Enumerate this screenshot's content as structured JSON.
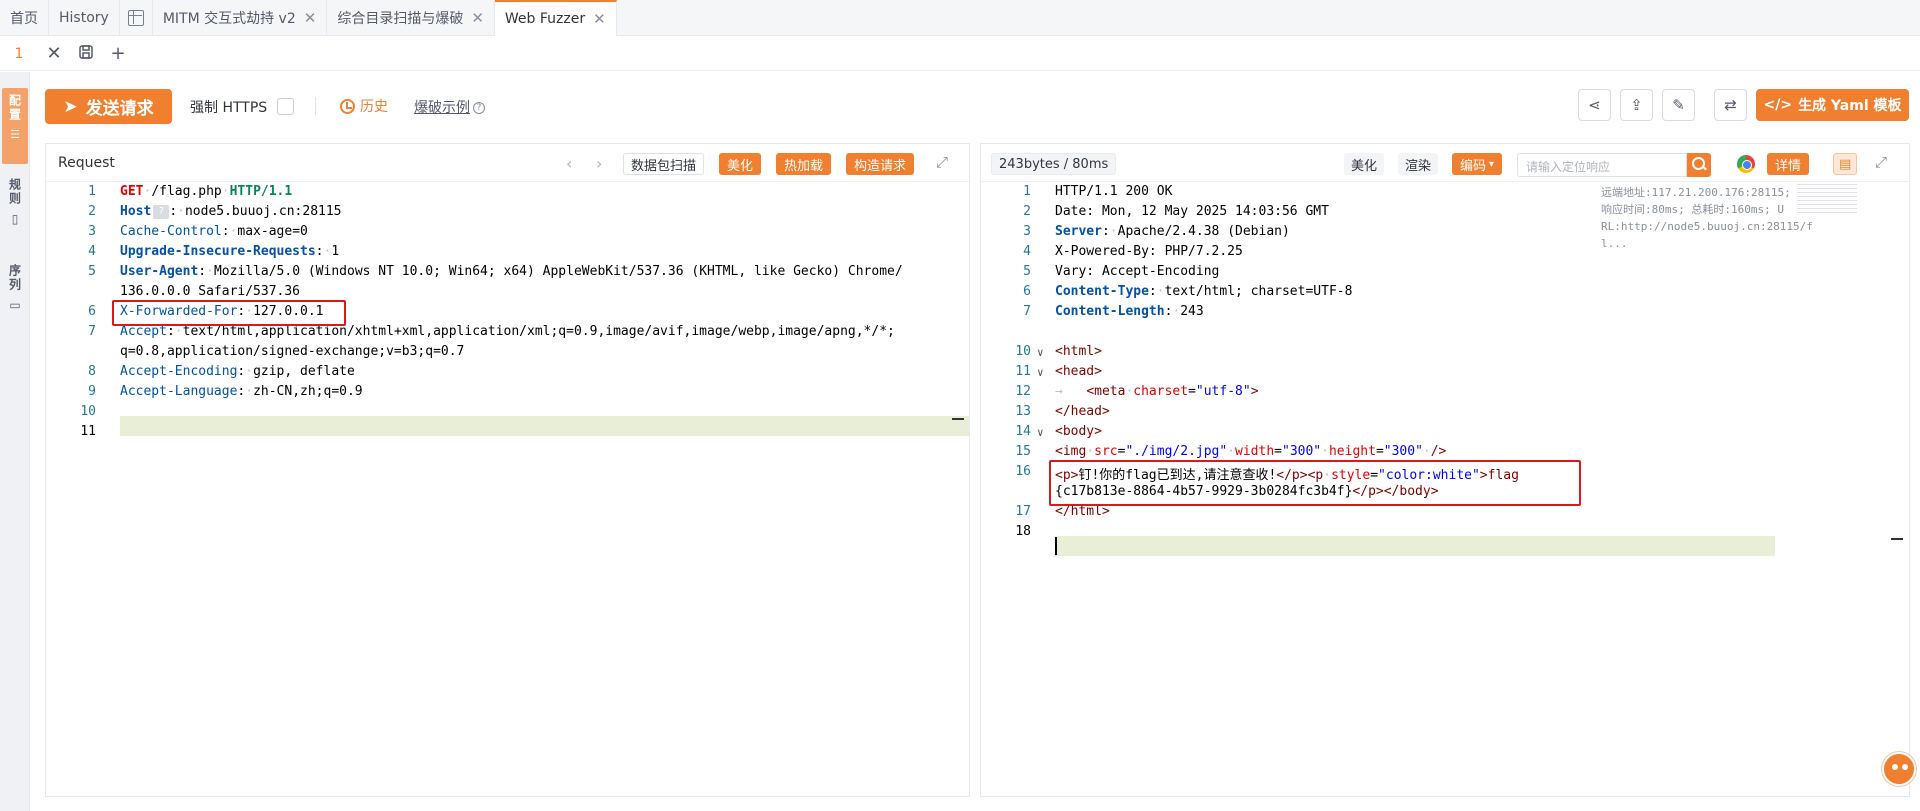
{
  "tabs": [
    {
      "label": "首页"
    },
    {
      "label": "History"
    },
    {
      "label": "MITM 交互式劫持 v2"
    },
    {
      "label": "综合目录扫描与爆破"
    },
    {
      "label": "Web Fuzzer"
    }
  ],
  "subbar": {
    "page_number": "1"
  },
  "left_strip": {
    "item_1": "配置",
    "item_2": "规则",
    "item_3": "序列"
  },
  "toolbar": {
    "send_label": "发送请求",
    "force_https_label": "强制 HTTPS",
    "history_label": "历史",
    "example_label": "爆破示例",
    "yaml_label": "生成 Yaml 模板"
  },
  "request": {
    "title": "Request",
    "scan_label": "数据包扫描",
    "beautify_label": "美化",
    "hotload_label": "热加载",
    "construct_label": "构造请求",
    "lines": {
      "l1_method": "GET",
      "l1_path": "/flag.php",
      "l1_proto": "HTTP/1.1",
      "l2_key": "Host",
      "l2_val": "node5.buuoj.cn:28115",
      "l3_key": "Cache-Control",
      "l3_val": "max-age=0",
      "l4_key": "Upgrade-Insecure-Requests",
      "l4_val": "1",
      "l5_key": "User-Agent",
      "l5_val": "Mozilla/5.0 (Windows NT 10.0; Win64; x64) AppleWebKit/537.36 (KHTML, like Gecko) Chrome/",
      "l5b_val": "136.0.0.0 Safari/537.36",
      "l6_key": "X-Forwarded-For",
      "l6_val": "127.0.0.1",
      "l7_key": "Accept",
      "l7_val": "text/html,application/xhtml+xml,application/xml;q=0.9,image/avif,image/webp,image/apng,*/*;",
      "l7b_val": "q=0.8,application/signed-exchange;v=b3;q=0.7",
      "l8_key": "Accept-Encoding",
      "l8_val": "gzip, deflate",
      "l9_key": "Accept-Language",
      "l9_val": "zh-CN,zh;q=0.9"
    }
  },
  "response": {
    "size_label": "243bytes / 80ms",
    "beautify_label": "美化",
    "render_label": "渲染",
    "encode_label": "编码",
    "search_placeholder": "请输入定位响应",
    "detail_label": "详情",
    "meta_line1": "远端地址:117.21.200.176:28115;",
    "meta_line2": "响应时间:80ms; 总耗时:160ms; U",
    "meta_line3": "RL:http://node5.buuoj.cn:28115/f",
    "meta_line4": "l...",
    "lines": {
      "l1": "HTTP/1.1 200 OK",
      "l2": "Date: Mon, 12 May 2025 14:03:56 GMT",
      "l3_key": "Server",
      "l3_val": "Apache/2.4.38 (Debian)",
      "l4": "X-Powered-By: PHP/7.2.25",
      "l5": "Vary: Accept-Encoding",
      "l6_key": "Content-Type",
      "l6_val": "text/html; charset=UTF-8",
      "l7_key": "Content-Length",
      "l7_val": "243",
      "l10": "<html>",
      "l11": "<head>",
      "l12_tag": "<meta",
      "l12_attr": "charset",
      "l12_val": "\"utf-8\"",
      "l12_end": ">",
      "l13": "</head>",
      "l14": "<body>",
      "l15_tag": "<img",
      "l15_a1": "src",
      "l15_v1": "\"./img/2.jpg\"",
      "l15_a2": "width",
      "l15_v2": "\"300\"",
      "l15_a3": "height",
      "l15_v3": "\"300\"",
      "l15_end": "/>",
      "l16_a": "<p>",
      "l16_text": "钉!你的flag已到达,请注意查收!",
      "l16_b": "</p><p",
      "l16_attr": "style",
      "l16_val": "\"color:white\"",
      "l16_c": ">flag",
      "l16b": "{c17b813e-8864-4b57-9929-3b0284fc3b4f}",
      "l16b_end": "</p></body>",
      "l17": "</html>"
    }
  },
  "colors": {
    "accent": "#f17f30",
    "highlight_box": "#e0161c"
  }
}
